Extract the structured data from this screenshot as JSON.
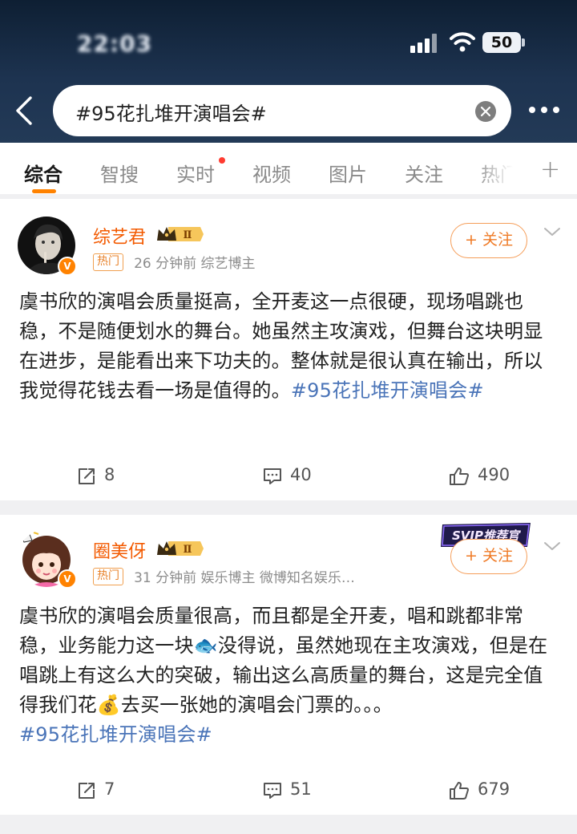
{
  "status_bar": {
    "time": "22:03",
    "battery": "50"
  },
  "search": {
    "query": "#95花扎堆开演唱会#"
  },
  "tabs": [
    {
      "label": "综合",
      "active": true
    },
    {
      "label": "智搜",
      "active": false
    },
    {
      "label": "实时",
      "active": false,
      "has_dot": true
    },
    {
      "label": "视频",
      "active": false
    },
    {
      "label": "图片",
      "active": false
    },
    {
      "label": "关注",
      "active": false
    },
    {
      "label": "热门",
      "active": false
    }
  ],
  "posts": [
    {
      "username": "综艺君",
      "rank_badge": "Ⅱ",
      "hot_tag": "热门",
      "meta": "26 分钟前   综艺博主",
      "follow_label": "+ 关注",
      "content_text": "虞书欣的演唱会质量挺高，全开麦这一点很硬，现场唱跳也稳，不是随便划水的舞台。她虽然主攻演戏，但舞台这块明显在进步，是能看出来下功夫的。整体就是很认真在输出，所以我觉得花钱去看一场是值得的。",
      "hashtag": "#95花扎堆开演唱会#",
      "reposts": "8",
      "comments": "40",
      "likes": "490"
    },
    {
      "username": "圈美伢",
      "rank_badge": "Ⅱ",
      "svip_label": "SVIP推荐官",
      "hot_tag": "热门",
      "meta": "31 分钟前   娱乐博主 微博知名娱乐…",
      "follow_label": "+ 关注",
      "content_part1": "虞书欣的演唱会质量很高，而且都是全开麦，唱和跳都非常稳，业务能力这一块",
      "emoji1": "🐟",
      "content_part2": "没得说，虽然她现在主攻演戏，但是在唱跳上有这么大的突破，输出这么高质量的舞台，这是完全值得我们花",
      "emoji2": "💰",
      "content_part3": "去买一张她的演唱会门票的。。。",
      "hashtag": "#95花扎堆开演唱会#",
      "reposts": "7",
      "comments": "51",
      "likes": "679"
    }
  ],
  "colors": {
    "accent": "#ff8200",
    "username": "#f35a00",
    "hashtag": "#4a74b8",
    "header_bg": "#1d3350"
  }
}
